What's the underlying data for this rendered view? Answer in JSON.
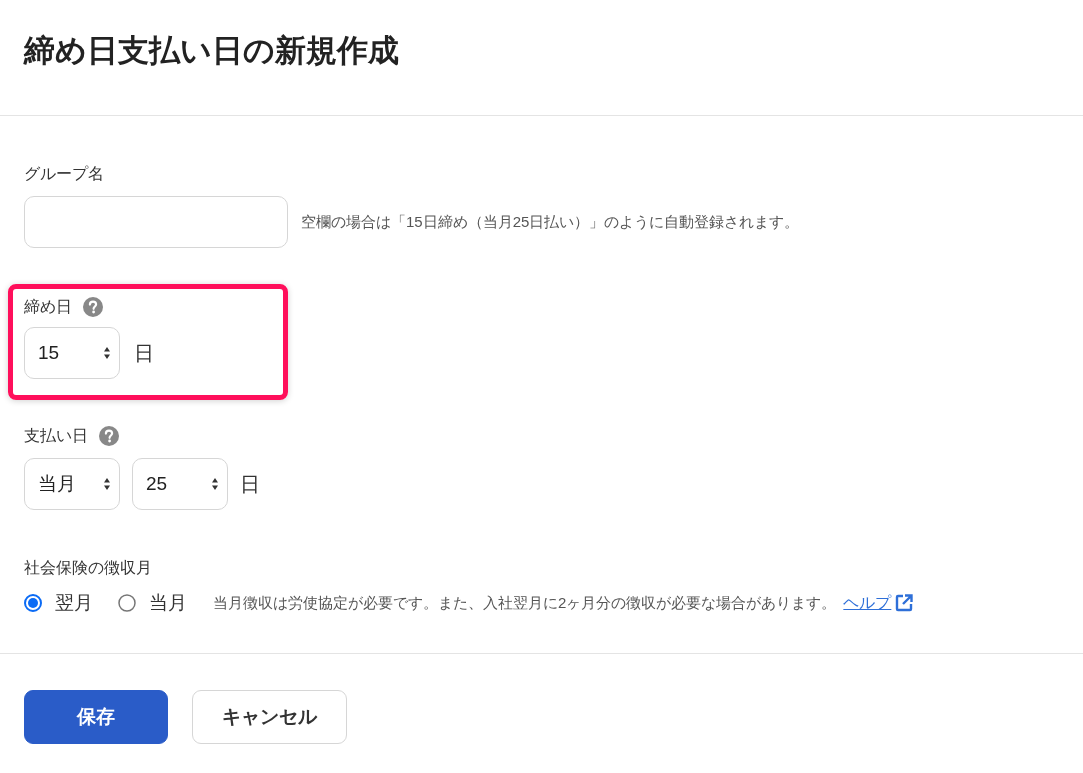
{
  "page": {
    "title": "締め日支払い日の新規作成"
  },
  "group_name": {
    "label": "グループ名",
    "hint": "空欄の場合は「15日締め（当月25日払い）」のように自動登録されます。"
  },
  "closing_day": {
    "label": "締め日",
    "help": true,
    "highlighted": true,
    "day": "15",
    "unit": "日"
  },
  "payment_day": {
    "label": "支払い日",
    "help": true,
    "month": "当月",
    "day": "25",
    "unit": "日"
  },
  "social_insurance": {
    "label": "社会保険の徴収月",
    "options": [
      {
        "label": "翌月",
        "selected": true
      },
      {
        "label": "当月",
        "selected": false
      }
    ],
    "note": "当月徴収は労使協定が必要です。また、入社翌月に2ヶ月分の徴収が必要な場合があります。",
    "link": {
      "text": "ヘルプ",
      "external": true
    }
  },
  "buttons": [
    {
      "label": "保存",
      "kind": "primary"
    },
    {
      "label": "キャンセル",
      "kind": "secondary"
    }
  ]
}
